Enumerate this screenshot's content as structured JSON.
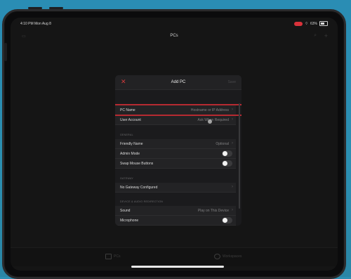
{
  "status_bar": {
    "time": "4:10 PM  Mon Aug 8",
    "battery": "63%"
  },
  "navbar": {
    "title": "PCs"
  },
  "tabs": [
    {
      "label": "PCs"
    },
    {
      "label": "Workspaces"
    }
  ],
  "modal": {
    "title": "Add PC",
    "save_label": "Save",
    "close_symbol": "✕",
    "rows": {
      "pc_name": {
        "label": "PC Name",
        "value": "Hostname or IP Address"
      },
      "user_account": {
        "label": "User Account",
        "value": "Ask When Required"
      }
    },
    "sections": {
      "general": "GENERAL",
      "gateway": "GATEWAY",
      "device_audio": "DEVICE & AUDIO REDIRECTION"
    },
    "general_rows": {
      "friendly_name": {
        "label": "Friendly Name",
        "value": "Optional"
      },
      "admin_mode": {
        "label": "Admin Mode",
        "on": false
      },
      "swap_mouse": {
        "label": "Swap Mouse Buttons",
        "on": false
      }
    },
    "gateway_row": {
      "label": "No Gateway Configured"
    },
    "device_rows": {
      "sound": {
        "label": "Sound",
        "value": "Play on This Device"
      },
      "microphone": {
        "label": "Microphone",
        "on": false
      }
    }
  },
  "colors": {
    "accent_red": "#d23a3c",
    "highlight_border": "#b62a31",
    "background": "#2e8fb3"
  },
  "icons": [
    "close-icon",
    "chevron-right-icon",
    "wifi-icon",
    "battery-icon",
    "recording-indicator-icon",
    "search-icon",
    "add-icon"
  ]
}
